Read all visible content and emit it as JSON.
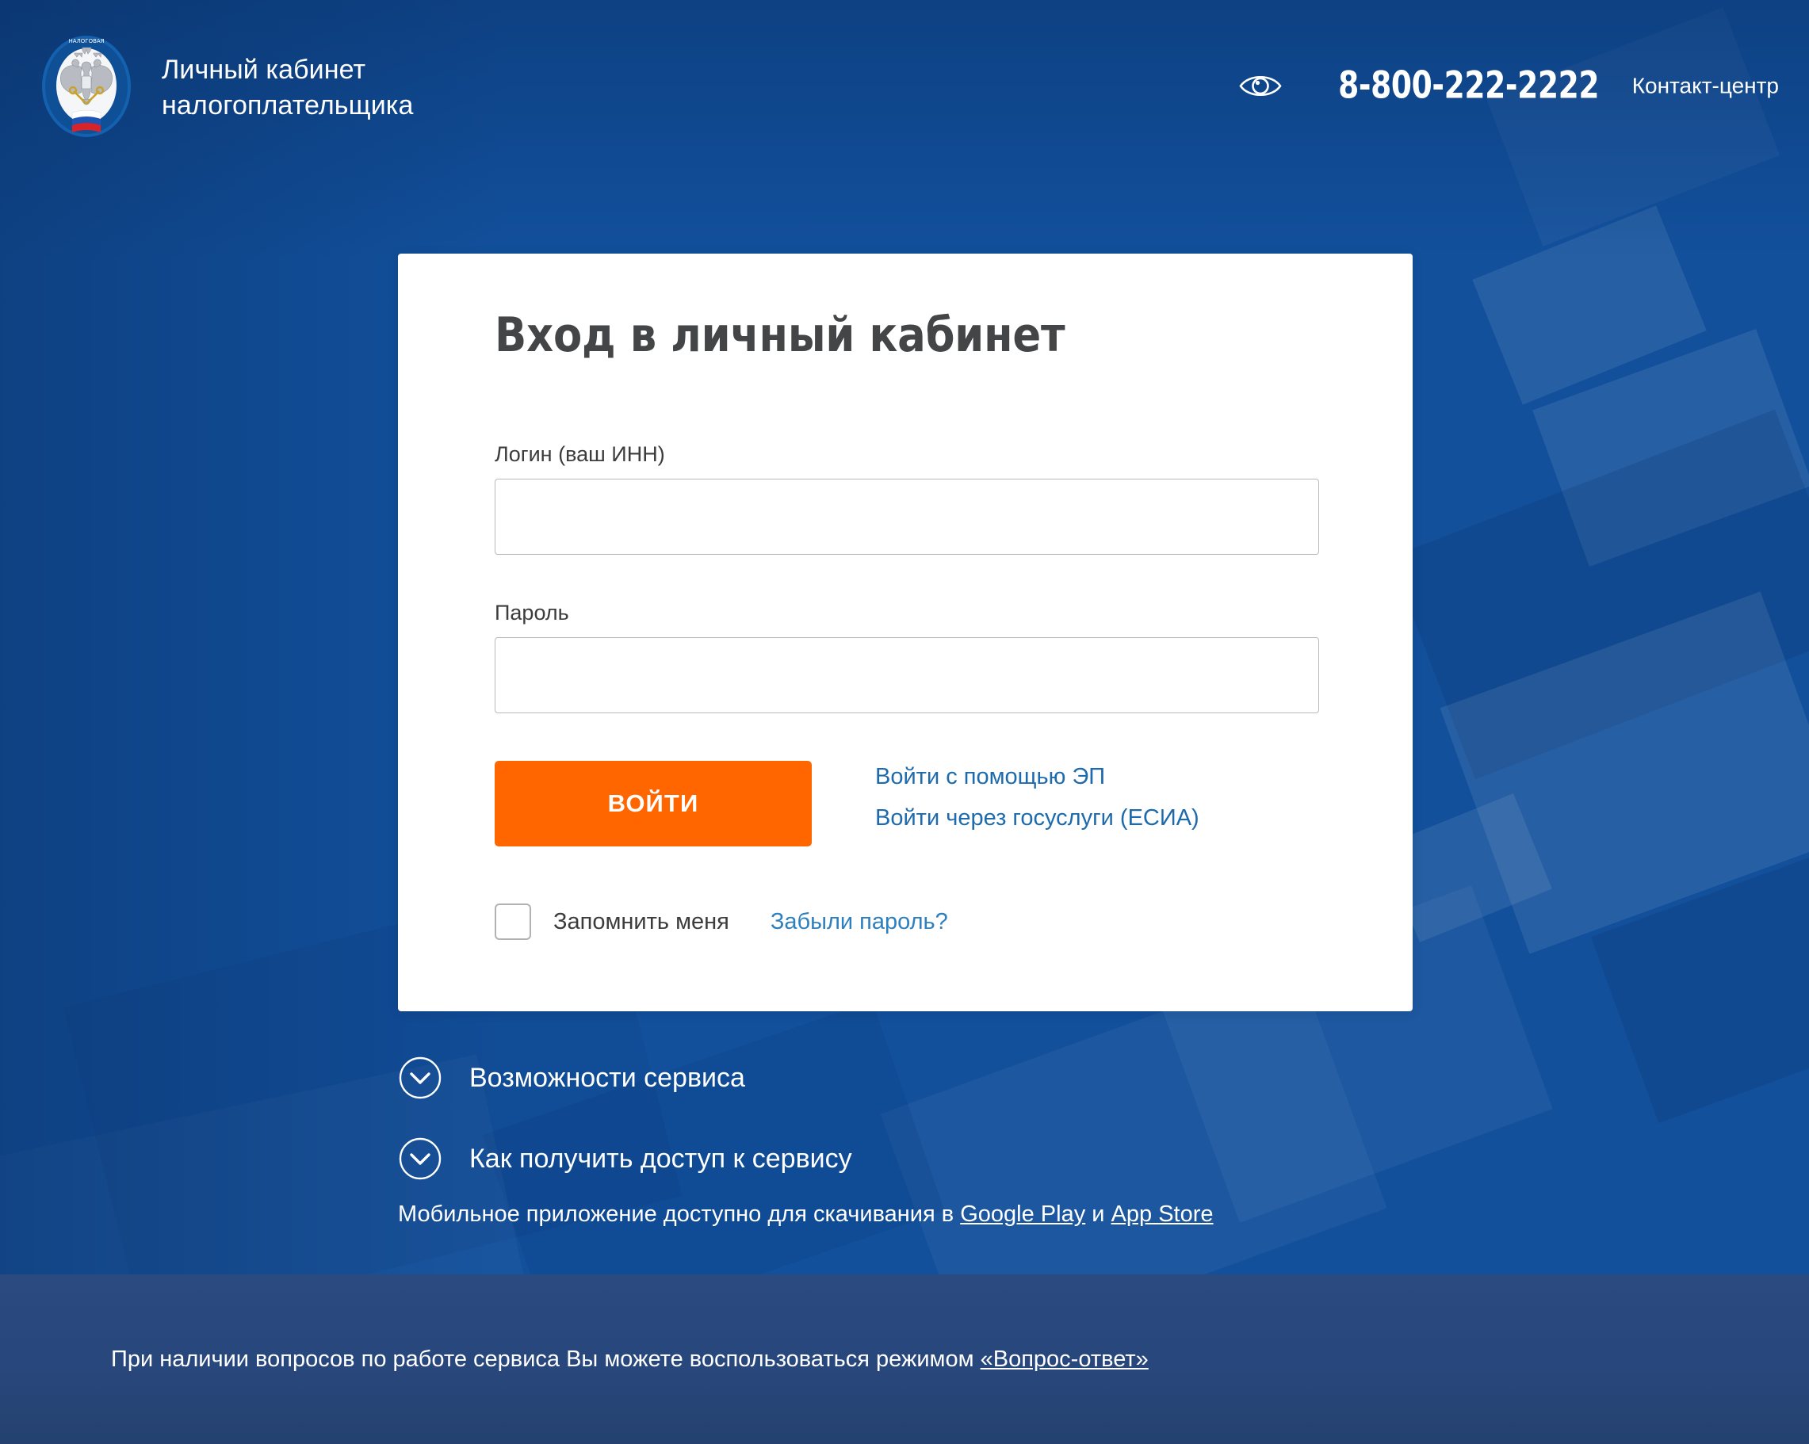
{
  "header": {
    "brand_title": "Личный кабинет\nналогоплательщика",
    "emblem_name": "federal-tax-service-emblem",
    "accessibility_icon": "eye-icon",
    "phone": "8-800-222-2222",
    "contact_center": "Контакт-центр"
  },
  "login_card": {
    "title": "Вход в личный кабинет",
    "login_field": {
      "label": "Логин (ваш ИНН)",
      "value": "",
      "placeholder": ""
    },
    "password_field": {
      "label": "Пароль",
      "value": "",
      "placeholder": ""
    },
    "submit_label": "ВОЙТИ",
    "alt_links": [
      "Войти с помощью ЭП",
      "Войти через госуслуги (ЕСИА)"
    ],
    "remember_label": "Запомнить меня",
    "remember_checked": false,
    "forgot_label": "Забыли пароль?"
  },
  "accordion": [
    {
      "label": "Возможности сервиса",
      "icon": "chevron-down-icon"
    },
    {
      "label": "Как получить доступ к сервису",
      "icon": "chevron-down-icon"
    }
  ],
  "mobile": {
    "prefix": "Мобильное приложение доступно для скачивания в ",
    "google_play": "Google Play",
    "conjunction": " и ",
    "app_store": "App Store"
  },
  "footer": {
    "prefix": "При наличии вопросов по работе сервиса Вы можете воспользоваться режимом ",
    "link": "«Вопрос-ответ»"
  },
  "colors": {
    "background_blue": "#12509c",
    "background_dark_blue": "#0d3f84",
    "card_white": "#ffffff",
    "accent_orange": "#ff6600",
    "link_blue": "#1d6aad",
    "forgot_link_blue": "#2d7fbe",
    "title_gray": "#444546",
    "footer_band": "#2a4a80",
    "input_border": "#b9b9b9"
  }
}
